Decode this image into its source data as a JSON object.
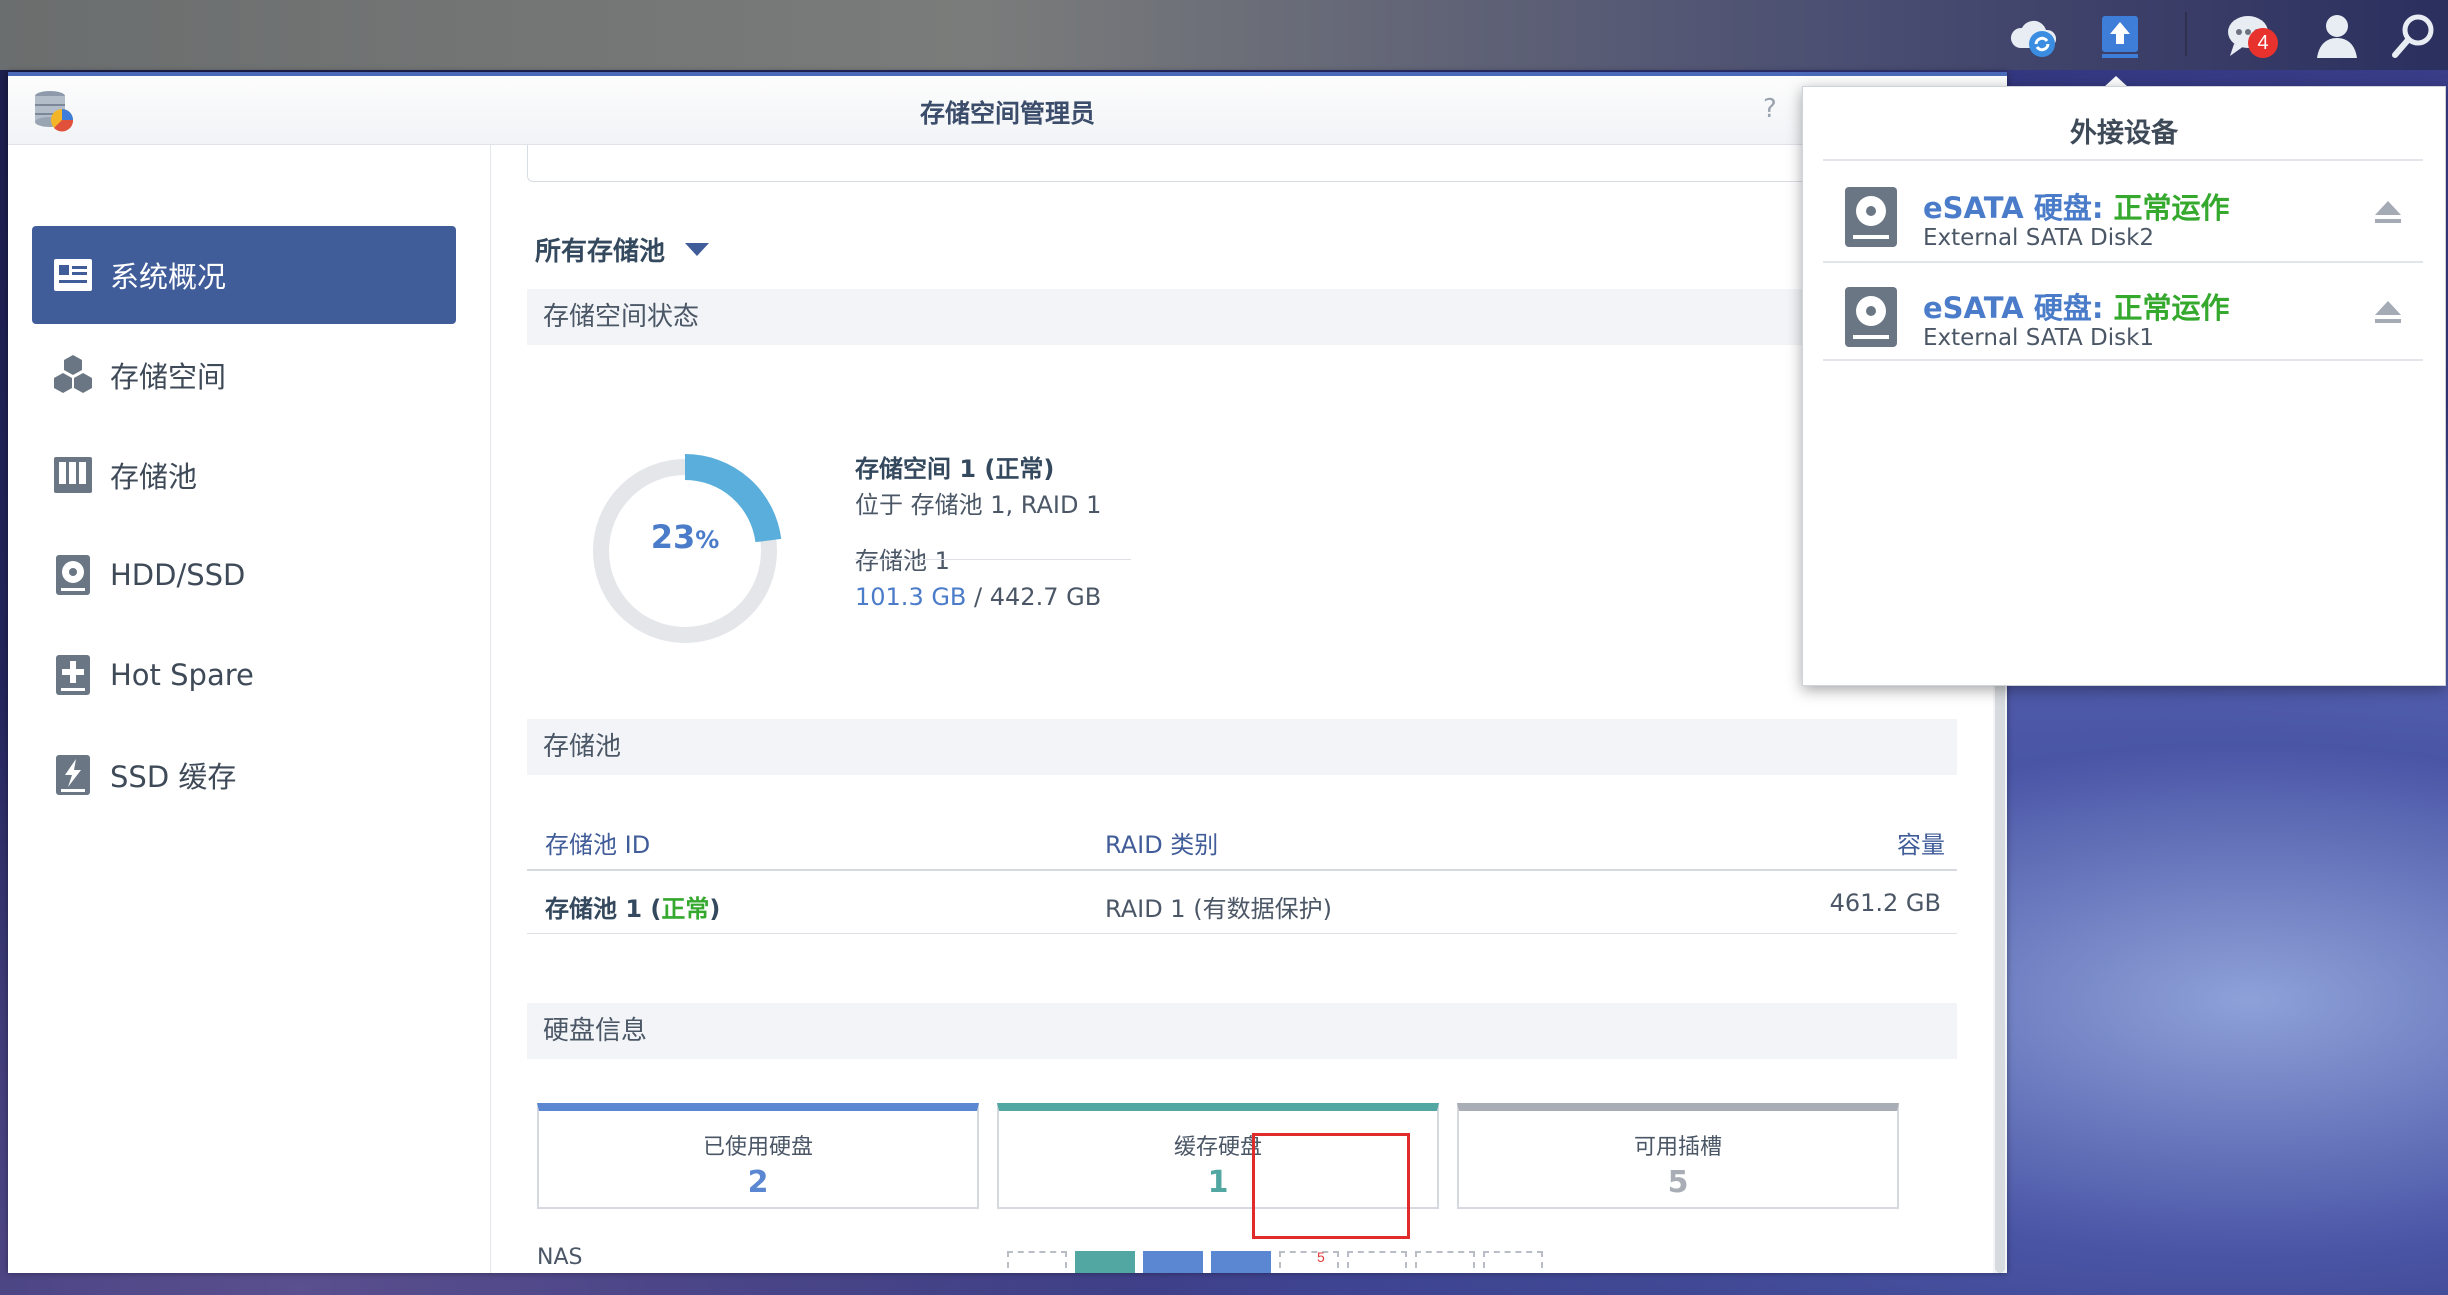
{
  "taskbar": {
    "notification_count": "4"
  },
  "window": {
    "title": "存储空间管理员",
    "help_glyph": "?"
  },
  "sidebar": {
    "items": [
      {
        "label": "系统概况",
        "icon": "overview-icon"
      },
      {
        "label": "存储空间",
        "icon": "volume-cubes-icon"
      },
      {
        "label": "存储池",
        "icon": "storage-pool-icon"
      },
      {
        "label": "HDD/SSD",
        "icon": "hdd-icon"
      },
      {
        "label": "Hot Spare",
        "icon": "hot-spare-icon"
      },
      {
        "label": "SSD 缓存",
        "icon": "ssd-cache-icon"
      }
    ]
  },
  "main": {
    "pool_filter": "所有存储池",
    "volume_status": {
      "section_title": "存储空间状态",
      "usage_percent": 23,
      "usage_number": "23",
      "usage_unit": "%",
      "volume_name": "存储空间 1",
      "volume_state": "正常",
      "location": "位于 存储池 1, RAID 1",
      "pool_name": "存储池 1",
      "used": "101.3 GB",
      "total_sep": "/ 442.7 GB"
    },
    "pool_section": {
      "section_title": "存储池",
      "headers": {
        "id": "存储池 ID",
        "raid": "RAID 类别",
        "capacity": "容量"
      },
      "rows": [
        {
          "id": "存储池 1",
          "state": "正常",
          "raid": "RAID 1 (有数据保护)",
          "capacity": "461.2 GB"
        }
      ]
    },
    "disk_section": {
      "section_title": "硬盘信息",
      "stats": [
        {
          "label": "已使用硬盘",
          "value": "2",
          "color": "#5b87d2"
        },
        {
          "label": "缓存硬盘",
          "value": "1",
          "color": "#53a7a2"
        },
        {
          "label": "可用插槽",
          "value": "5",
          "color": "#a8adb6"
        }
      ],
      "nas_label": "NAS",
      "slots": [
        "empty",
        "teal",
        "blue",
        "blue",
        "empty",
        "empty",
        "empty",
        "empty"
      ],
      "slot_5_label": "5"
    }
  },
  "popup": {
    "title": "外接设备",
    "devices": [
      {
        "name": "eSATA 硬盘:",
        "status": "正常运作",
        "subtitle": "External SATA Disk2"
      },
      {
        "name": "eSATA 硬盘:",
        "status": "正常运作",
        "subtitle": "External SATA Disk1"
      }
    ]
  },
  "colors": {
    "accent": "#405c99",
    "ok_green": "#35a82e",
    "link_blue": "#4a7cc9"
  }
}
